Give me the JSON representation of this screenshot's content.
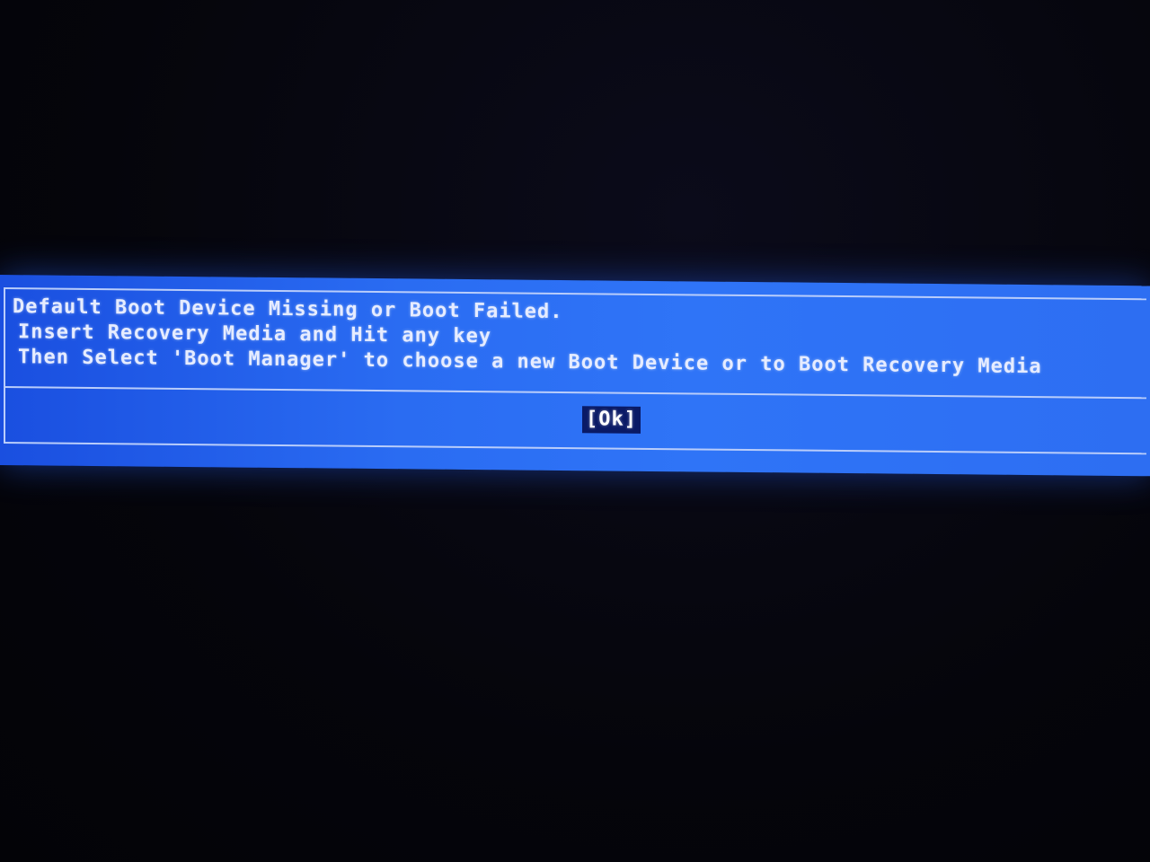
{
  "dialog": {
    "lines": [
      "Default Boot Device Missing or Boot Failed.",
      "Insert Recovery Media and Hit any key",
      "Then Select 'Boot Manager' to choose a new Boot Device or to Boot Recovery Media"
    ],
    "ok_label": "[Ok]"
  },
  "colors": {
    "dialog_background": "#2a6cf2",
    "border": "#b9cdfb",
    "text": "#e6ecff",
    "selected_button_background": "#0a1a66",
    "screen_background": "#06060d"
  }
}
